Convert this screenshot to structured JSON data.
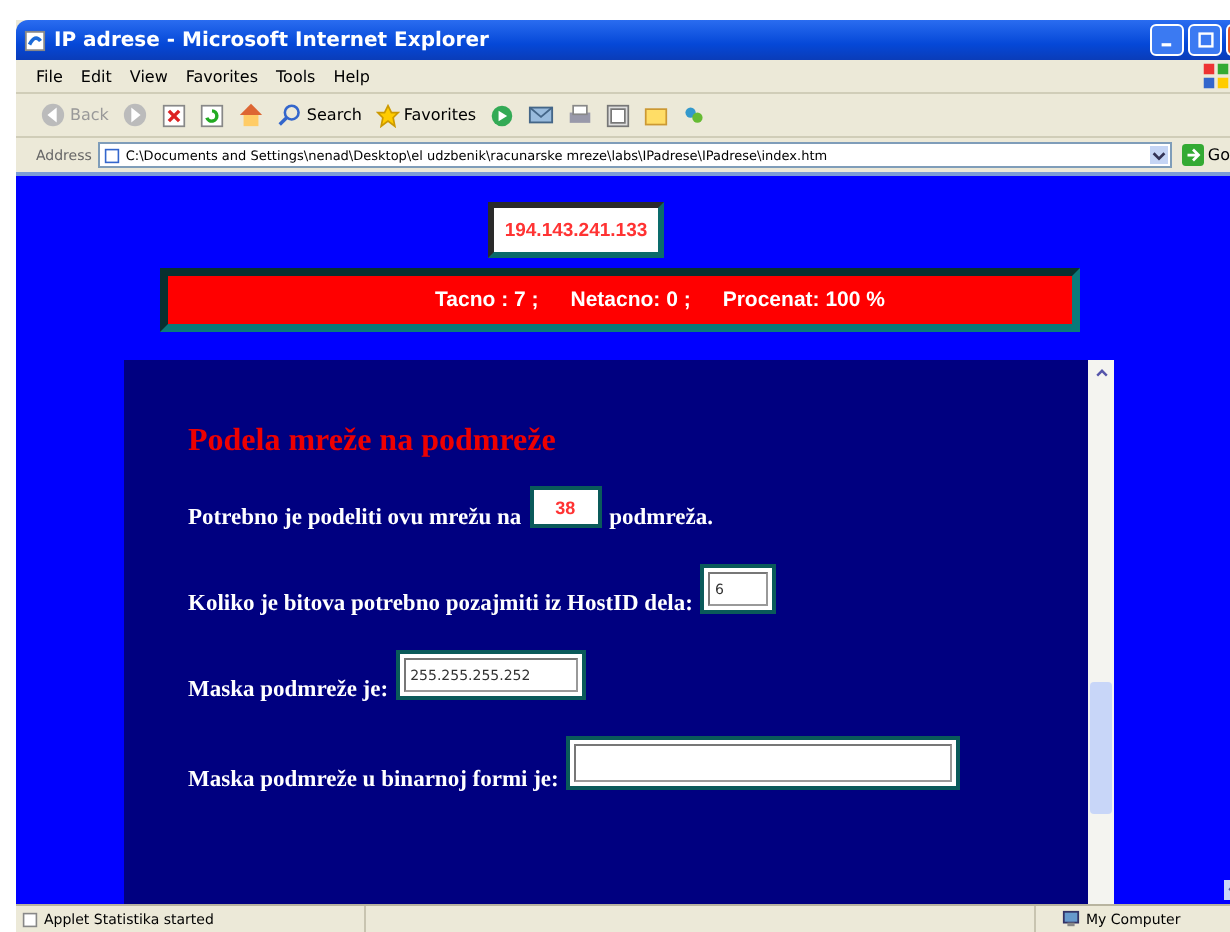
{
  "window": {
    "title": "IP adrese - Microsoft Internet Explorer"
  },
  "menu": [
    "File",
    "Edit",
    "View",
    "Favorites",
    "Tools",
    "Help"
  ],
  "toolbar": [
    {
      "kind": "back",
      "label": "Back",
      "disabled": true
    },
    {
      "kind": "forward",
      "disabled": true
    },
    {
      "kind": "stop"
    },
    {
      "kind": "refresh"
    },
    {
      "kind": "home"
    },
    {
      "kind": "search",
      "label": "Search"
    },
    {
      "kind": "favorites",
      "label": "Favorites"
    },
    {
      "kind": "media"
    },
    {
      "kind": "mail"
    },
    {
      "kind": "print"
    },
    {
      "kind": "edit"
    },
    {
      "kind": "folder"
    },
    {
      "kind": "messenger"
    }
  ],
  "address": {
    "label": "Address",
    "value": "C:\\Documents and Settings\\nenad\\Desktop\\el udzbenik\\racunarske mreze\\labs\\IPadrese\\IPadrese\\index.htm",
    "go": "Go"
  },
  "page": {
    "ip": "194.143.241.133",
    "score": [
      "Tacno : 7 ;",
      "Netacno: 0 ;",
      "Procenat: 100 %"
    ],
    "heading": "Podela mreže na podmreže",
    "questions": [
      {
        "kind": "display",
        "text": "Potrebno je podeliti ovu mrežu na",
        "value": "38",
        "after": "podmreža."
      },
      {
        "kind": "input",
        "text": "Koliko je bitova potrebno pozajmiti iz HostID dela:",
        "value": "6"
      },
      {
        "kind": "input",
        "text": "Maska podmreže je:",
        "value": "255.255.255.252"
      },
      {
        "kind": "input",
        "text": "Maska podmreže u binarnoj formi je:"
      }
    ]
  },
  "status_bar": {
    "text": "Applet Statistika started",
    "zone": "My Computer"
  }
}
